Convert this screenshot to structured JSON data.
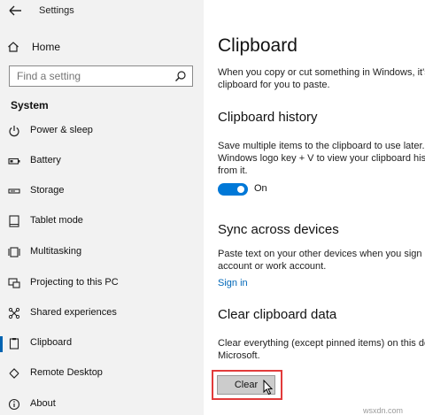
{
  "header": {
    "title": "Settings",
    "back_icon": "back-arrow-icon"
  },
  "sidebar": {
    "home_label": "Home",
    "search_placeholder": "Find a setting",
    "section_title": "System",
    "items": [
      {
        "label": "Power & sleep",
        "icon": "power-icon"
      },
      {
        "label": "Battery",
        "icon": "battery-icon"
      },
      {
        "label": "Storage",
        "icon": "storage-icon"
      },
      {
        "label": "Tablet mode",
        "icon": "tablet-icon"
      },
      {
        "label": "Multitasking",
        "icon": "multitasking-icon"
      },
      {
        "label": "Projecting to this PC",
        "icon": "projecting-icon"
      },
      {
        "label": "Shared experiences",
        "icon": "shared-icon"
      },
      {
        "label": "Clipboard",
        "icon": "clipboard-icon",
        "active": true
      },
      {
        "label": "Remote Desktop",
        "icon": "remote-desktop-icon"
      },
      {
        "label": "About",
        "icon": "info-icon"
      }
    ]
  },
  "main": {
    "title": "Clipboard",
    "intro": [
      "When you copy or cut something in Windows, it's",
      "clipboard for you to paste."
    ],
    "history": {
      "heading": "Clipboard history",
      "desc": [
        "Save multiple items to the clipboard to use later.",
        "Windows logo key + V to view your clipboard his",
        "from it."
      ],
      "toggle_state": "On"
    },
    "sync": {
      "heading": "Sync across devices",
      "desc": [
        "Paste text on your other devices when you sign in",
        "account or work account."
      ],
      "link": "Sign in"
    },
    "clear": {
      "heading": "Clear clipboard data",
      "desc": [
        "Clear everything (except pinned items) on this de",
        "Microsoft."
      ],
      "button": "Clear"
    }
  },
  "colors": {
    "accent": "#0078d7",
    "link": "#0067b8",
    "highlight": "#e23b3b",
    "sidebar_bg": "#f2f2f2"
  },
  "watermark": "wsxdn.com"
}
